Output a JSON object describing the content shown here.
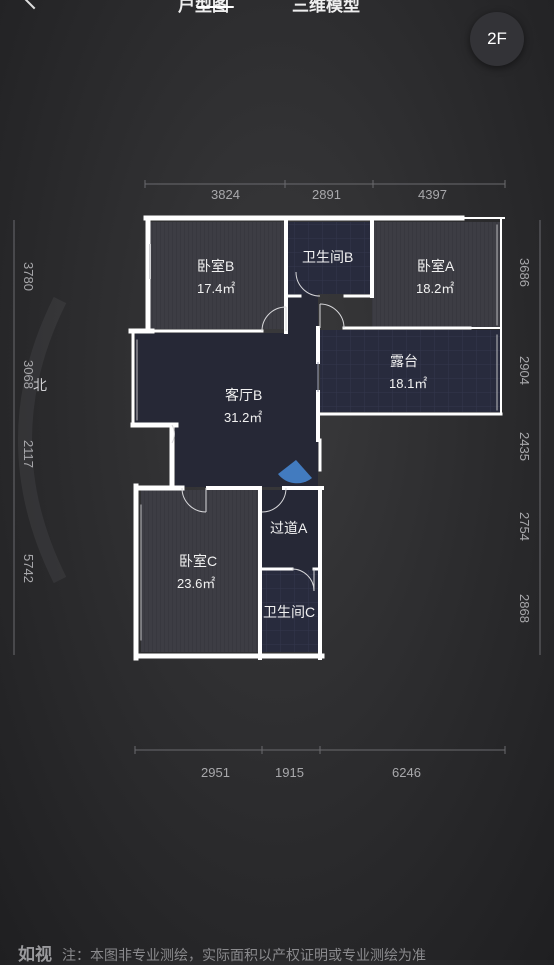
{
  "header": {
    "tabs": [
      {
        "label": "户型图"
      },
      {
        "label": "三维模型"
      }
    ]
  },
  "floor_selector": {
    "label": "2F"
  },
  "dimensions": {
    "top": [
      "3824",
      "2891",
      "4397"
    ],
    "bottom": [
      "2951",
      "1915",
      "6246"
    ],
    "left": [
      "3780",
      "3068",
      "2117",
      "5742"
    ],
    "right": [
      "3686",
      "2904",
      "2435",
      "2754",
      "2868"
    ]
  },
  "rooms": [
    {
      "name": "卧室B",
      "area": "17.4㎡"
    },
    {
      "name": "卫生间B",
      "area": ""
    },
    {
      "name": "卧室A",
      "area": "18.2㎡"
    },
    {
      "name": "露台",
      "area": "18.1㎡"
    },
    {
      "name": "客厅B",
      "area": "31.2㎡"
    },
    {
      "name": "卧室C",
      "area": "23.6㎡"
    },
    {
      "name": "过道A",
      "area": ""
    },
    {
      "name": "卫生间C",
      "area": ""
    }
  ],
  "compass": {
    "label": "北"
  },
  "footer": {
    "logo": "如视",
    "disclaimer": "注：本图非专业测绘，实际面积以产权证明或专业测绘为准"
  },
  "colors": {
    "background": "#2b2b2d",
    "room_fill": "#3a3a42",
    "corridor_fill": "#262836",
    "bath_fill": "#2a2d40",
    "wall": "#ffffff",
    "camera_cone": "#4a90e2"
  }
}
